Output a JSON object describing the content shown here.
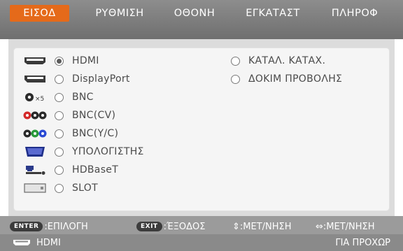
{
  "tabs": [
    {
      "label": "ΕΙΣΟΔ",
      "active": true
    },
    {
      "label": "ΡΥΘΜΙΣΗ",
      "active": false
    },
    {
      "label": "ΟΘΟΝΗ",
      "active": false
    },
    {
      "label": "ΕΓΚΑΤΑΣΤ",
      "active": false
    },
    {
      "label": "ΠΛΗΡΟΦ",
      "active": false
    }
  ],
  "inputs": [
    {
      "label": "HDMI",
      "icon": "hdmi-connector-icon",
      "selected": true
    },
    {
      "label": "DisplayPort",
      "icon": "displayport-connector-icon",
      "selected": false
    },
    {
      "label": "BNC",
      "icon": "bnc-connector-x5-icon",
      "icon_text": "×5",
      "selected": false
    },
    {
      "label": "BNC(CV)",
      "icon": "bnc-cv-connectors-icon",
      "selected": false
    },
    {
      "label": "BNC(Y/C)",
      "icon": "bnc-yc-connectors-icon",
      "selected": false
    },
    {
      "label": "ΥΠΟΛΟΓΙΣΤΗΣ",
      "icon": "computer-vga-connector-icon",
      "selected": false
    },
    {
      "label": "HDBaseT",
      "icon": "hdbaset-network-icon",
      "selected": false
    },
    {
      "label": "SLOT",
      "icon": "slot-card-icon",
      "selected": false
    }
  ],
  "extra_options": [
    {
      "label": "ΚΑΤΑΛ. ΚΑΤΑΧ.",
      "selected": false
    },
    {
      "label": "ΔΟΚΙΜ ΠΡΟΒΟΛΗΣ",
      "selected": false
    }
  ],
  "footer": {
    "hints": [
      {
        "key": "ENTER",
        "text": ":ΕΠΙΛΟΓΗ"
      },
      {
        "key": "EXIT",
        "text": ":ΈΞΟΔΟΣ"
      },
      {
        "key": "⇕",
        "text": ":ΜΕΤ/ΝΗΣΗ"
      },
      {
        "key": "⇔",
        "text": ":ΜΕΤ/ΝΗΣΗ"
      }
    ],
    "current_input": "HDMI",
    "advanced_label": "ΓΙΑ ΠΡΟΧΩΡ"
  },
  "colors": {
    "accent": "#e56a1a",
    "tab_bar": "#7f7f7f",
    "panel_bg": "#dcdcdc",
    "footer_bg": "#9b9b9b"
  }
}
